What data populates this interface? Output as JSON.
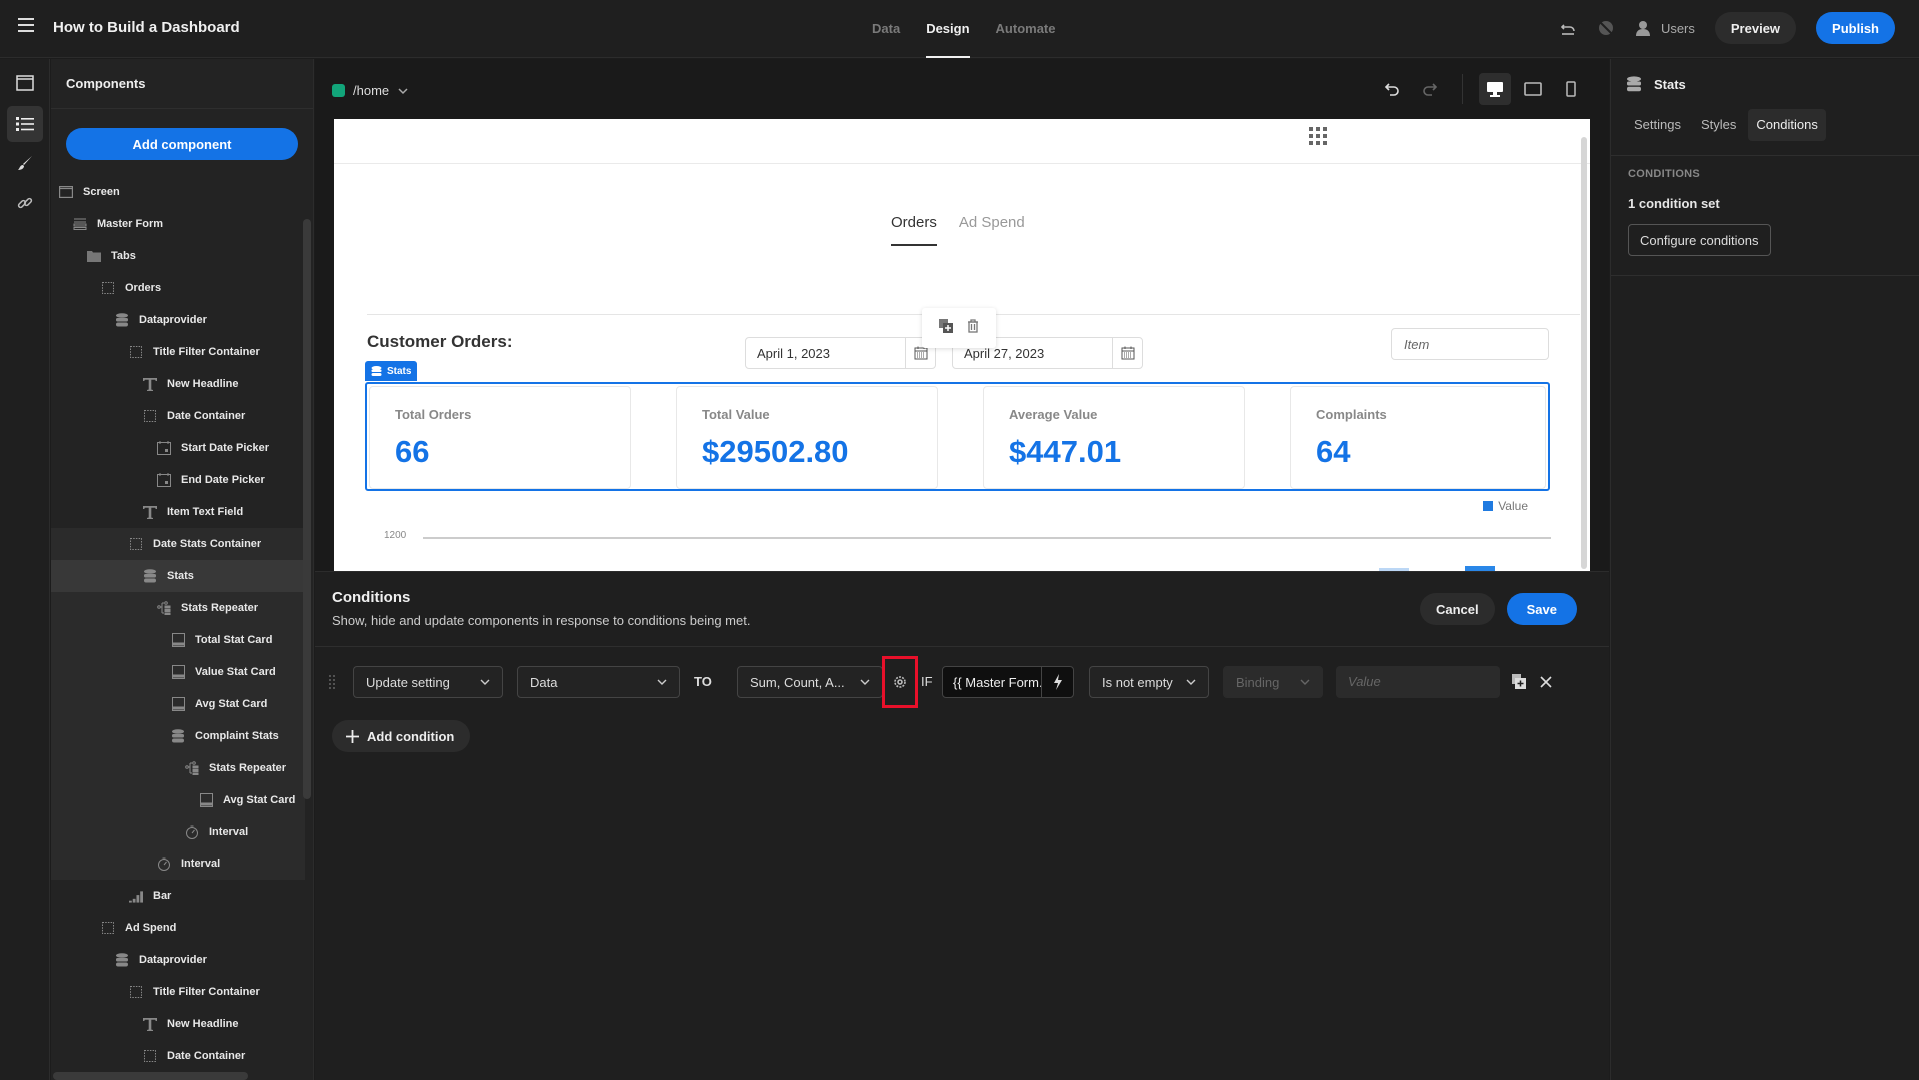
{
  "app": {
    "title": "How to Build a Dashboard",
    "nav": [
      "Data",
      "Design",
      "Automate"
    ],
    "active_nav": "Design",
    "users_label": "Users",
    "preview_label": "Preview",
    "publish_label": "Publish",
    "accent": "#1473e6"
  },
  "components_panel": {
    "title": "Components",
    "add_label": "Add component",
    "tree": [
      {
        "label": "Screen",
        "icon": "screen-icon",
        "depth": 0
      },
      {
        "label": "Master Form",
        "icon": "form-icon",
        "depth": 1
      },
      {
        "label": "Tabs",
        "icon": "folder-icon",
        "depth": 2
      },
      {
        "label": "Orders",
        "icon": "container-icon",
        "depth": 3
      },
      {
        "label": "Dataprovider",
        "icon": "database-icon",
        "depth": 4
      },
      {
        "label": "Title Filter Container",
        "icon": "container-icon",
        "depth": 5
      },
      {
        "label": "New Headline",
        "icon": "text-icon",
        "depth": 6
      },
      {
        "label": "Date Container",
        "icon": "container-icon",
        "depth": 6
      },
      {
        "label": "Start Date Picker",
        "icon": "date-picker-icon",
        "depth": 7
      },
      {
        "label": "End Date Picker",
        "icon": "date-picker-icon",
        "depth": 7
      },
      {
        "label": "Item Text Field",
        "icon": "text-icon",
        "depth": 6
      },
      {
        "label": "Date Stats Container",
        "icon": "container-icon",
        "depth": 5
      },
      {
        "label": "Stats",
        "icon": "database-icon",
        "depth": 6,
        "selected": true
      },
      {
        "label": "Stats Repeater",
        "icon": "repeater-icon",
        "depth": 7
      },
      {
        "label": "Total Stat Card",
        "icon": "card-icon",
        "depth": 8
      },
      {
        "label": "Value Stat Card",
        "icon": "card-icon",
        "depth": 8
      },
      {
        "label": "Avg Stat Card",
        "icon": "card-icon",
        "depth": 8
      },
      {
        "label": "Complaint Stats",
        "icon": "database-icon",
        "depth": 8
      },
      {
        "label": "Stats Repeater",
        "icon": "repeater-icon",
        "depth": 9
      },
      {
        "label": "Avg Stat Card",
        "icon": "card-icon",
        "depth": 10
      },
      {
        "label": "Interval",
        "icon": "timer-icon",
        "depth": 9
      },
      {
        "label": "Interval",
        "icon": "timer-icon",
        "depth": 7
      },
      {
        "label": "Bar",
        "icon": "bar-chart-icon",
        "depth": 5
      },
      {
        "label": "Ad Spend",
        "icon": "container-icon",
        "depth": 3
      },
      {
        "label": "Dataprovider",
        "icon": "database-icon",
        "depth": 4
      },
      {
        "label": "Title Filter Container",
        "icon": "container-icon",
        "depth": 5
      },
      {
        "label": "New Headline",
        "icon": "text-icon",
        "depth": 6
      },
      {
        "label": "Date Container",
        "icon": "container-icon",
        "depth": 6
      }
    ]
  },
  "canvas": {
    "route": "/home",
    "route_color": "#12a57a",
    "page": {
      "tabs": [
        "Orders",
        "Ad Spend"
      ],
      "active_tab": "Orders",
      "heading": "Customer Orders:",
      "start_date": "April 1, 2023",
      "end_date": "April 27, 2023",
      "item_placeholder": "Item",
      "stats_badge": "Stats",
      "stat_cards": [
        {
          "label": "Total Orders",
          "value": "66"
        },
        {
          "label": "Total Value",
          "value": "$29502.80"
        },
        {
          "label": "Average Value",
          "value": "$447.01"
        },
        {
          "label": "Complaints",
          "value": "64"
        }
      ],
      "chart": {
        "legend": "Value",
        "y_tick": "1200"
      }
    }
  },
  "conditions": {
    "title": "Conditions",
    "subtitle": "Show, hide and update components in response to conditions being met.",
    "cancel_label": "Cancel",
    "save_label": "Save",
    "rows": [
      {
        "action": "Update setting",
        "setting": "Data",
        "to_label": "TO",
        "value": "Sum, Count, A...",
        "if_label": "IF",
        "binding": "{{ Master Form.F...",
        "operator": "Is not empty",
        "type": "Binding",
        "compare_placeholder": "Value"
      }
    ],
    "add_label": "Add condition"
  },
  "settings_panel": {
    "component": "Stats",
    "tabs": [
      "Settings",
      "Styles",
      "Conditions"
    ],
    "active_tab": "Conditions",
    "section_label": "CONDITIONS",
    "count_text": "1 condition set",
    "configure_label": "Configure conditions"
  }
}
